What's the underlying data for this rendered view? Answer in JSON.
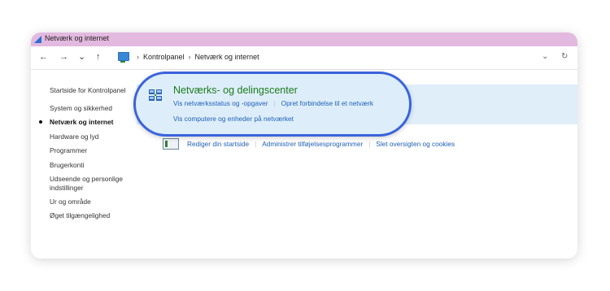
{
  "window": {
    "title": "Netværk og internet"
  },
  "nav": {
    "back": "←",
    "forward": "→",
    "recent": "⌄",
    "up": "↑"
  },
  "address": {
    "crumbs": [
      "Kontrolpanel",
      "Netværk og internet"
    ],
    "separator": "›",
    "dropdown": "⌄",
    "refresh": "↻"
  },
  "sidebar": {
    "items": [
      {
        "label": "Startside for Kontrolpanel",
        "active": false
      },
      {
        "label": "System og sikkerhed",
        "active": false
      },
      {
        "label": "Netværk og internet",
        "active": true
      },
      {
        "label": "Hardware og lyd",
        "active": false
      },
      {
        "label": "Programmer",
        "active": false
      },
      {
        "label": "Brugerkonti",
        "active": false
      },
      {
        "label": "Udseende og personlige",
        "active": false
      },
      {
        "label": "indstillinger",
        "active": false
      },
      {
        "label": "Ur  og område",
        "active": false
      },
      {
        "label": "Øget tilgængelighed",
        "active": false
      }
    ]
  },
  "highlight": {
    "title": "Netværks- og delingscenter",
    "links": [
      "Vis netværksstatus og -opgaver",
      "Opret forbindelse til et netværk",
      "Vis computere og enheder på netværket"
    ],
    "icon": "network-sharing-icon"
  },
  "second_category": {
    "icon": "document-icon",
    "links": [
      "Rediger din startside",
      "Administrer tilføjelsesprogrammer",
      "Slet oversigten og cookies"
    ]
  },
  "colors": {
    "titlebar": "#e3b9df",
    "callout_border": "#3a63dc",
    "title_green": "#1c7a1c",
    "link_blue": "#1f5fb8"
  }
}
